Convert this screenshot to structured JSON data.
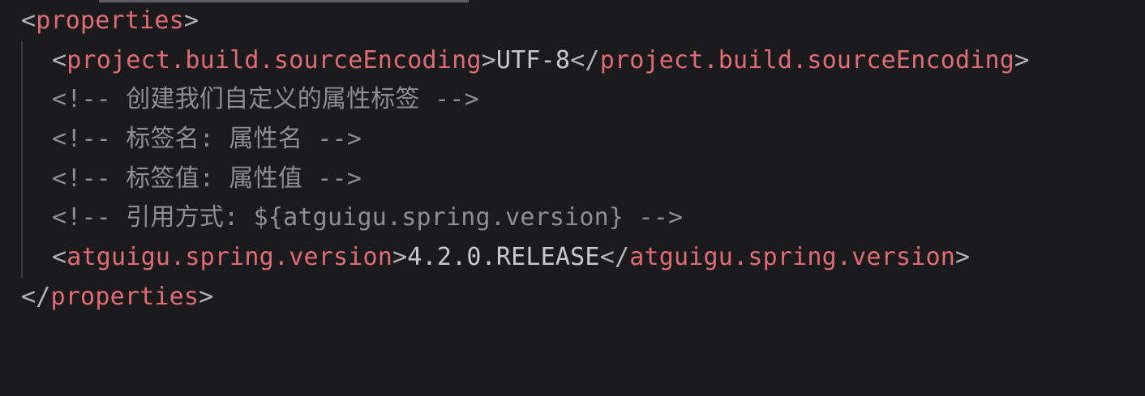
{
  "colors": {
    "background": "#1b1b1d",
    "tag": "#e06c75",
    "punctuation": "#b4b4b8",
    "text": "#c9c9cc",
    "comment": "#8f8f93"
  },
  "code": {
    "open_tag": "properties",
    "encoding_tag": "project.build.sourceEncoding",
    "encoding_value": "UTF-8",
    "comments": [
      "<!-- 创建我们自定义的属性标签 -->",
      "<!-- 标签名: 属性名 -->",
      "<!-- 标签值: 属性值 -->",
      "<!-- 引用方式: ${atguigu.spring.version} -->"
    ],
    "version_tag": "atguigu.spring.version",
    "version_value": "4.2.0.RELEASE",
    "close_tag": "properties"
  }
}
